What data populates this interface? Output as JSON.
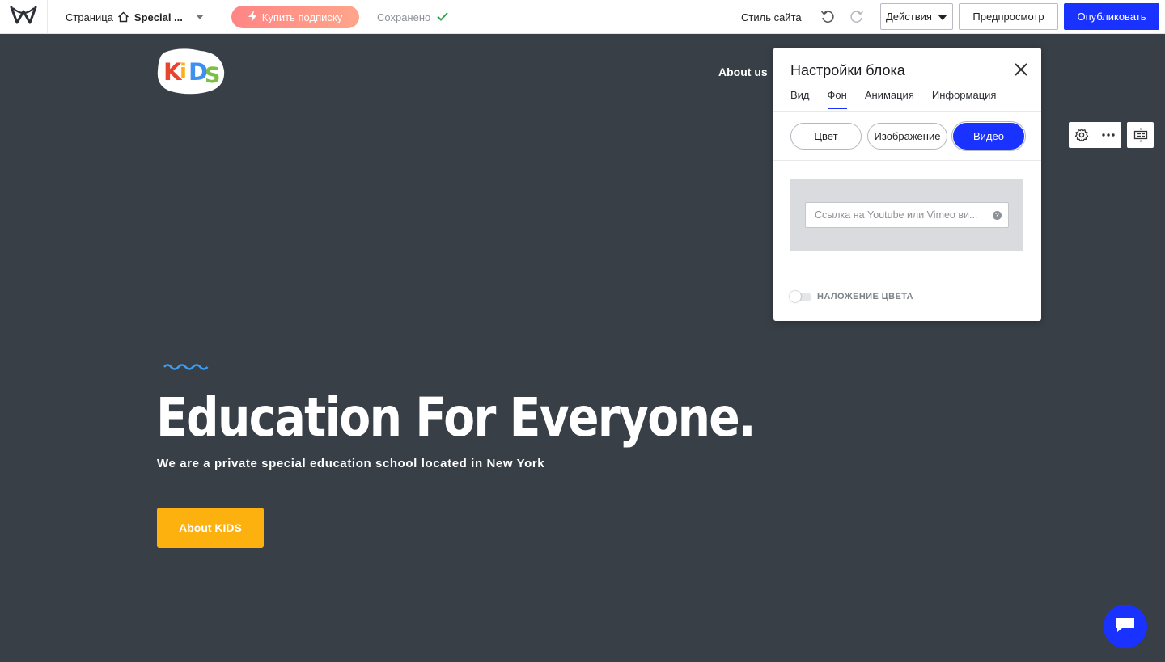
{
  "topbar": {
    "page_label": "Страница",
    "page_name": "Special ...",
    "subscribe_label": "Купить подписку",
    "saved_label": "Сохранено",
    "site_style_label": "Стиль сайта",
    "actions_label": "Действия",
    "preview_label": "Предпросмотр",
    "publish_label": "Опубликовать"
  },
  "site": {
    "logo_text": "KiDS",
    "nav": [
      "About us"
    ],
    "hero_title": "Education For Everyone.",
    "hero_subtitle": "We are a private special education school located in New York",
    "hero_button": "About KIDS"
  },
  "panel": {
    "title": "Настройки блока",
    "tabs": [
      {
        "label": "Вид",
        "active": false
      },
      {
        "label": "Фон",
        "active": true
      },
      {
        "label": "Анимация",
        "active": false
      },
      {
        "label": "Информация",
        "active": false
      }
    ],
    "segments": [
      {
        "label": "Цвет",
        "active": false
      },
      {
        "label": "Изображение",
        "active": false
      },
      {
        "label": "Видео",
        "active": true
      }
    ],
    "video_placeholder": "Ссылка на Youtube или Vimeo ви...",
    "overlay_label": "НАЛОЖЕНИЕ ЦВЕТА",
    "overlay_enabled": false
  },
  "colors": {
    "accent": "#1a32ff",
    "canvas_bg": "#383f47",
    "hero_button": "#fdb10f",
    "saved_check": "#2e9e4f"
  },
  "icons": {
    "logo": "weebly-logo-icon",
    "home": "home-icon",
    "caret": "chevron-down-icon",
    "bolt": "lightning-icon",
    "check": "check-icon",
    "undo": "undo-icon",
    "redo": "redo-icon",
    "close": "close-icon",
    "settings": "gear-icon",
    "more": "more-icon",
    "layout": "layout-icon",
    "chat": "chat-icon"
  }
}
